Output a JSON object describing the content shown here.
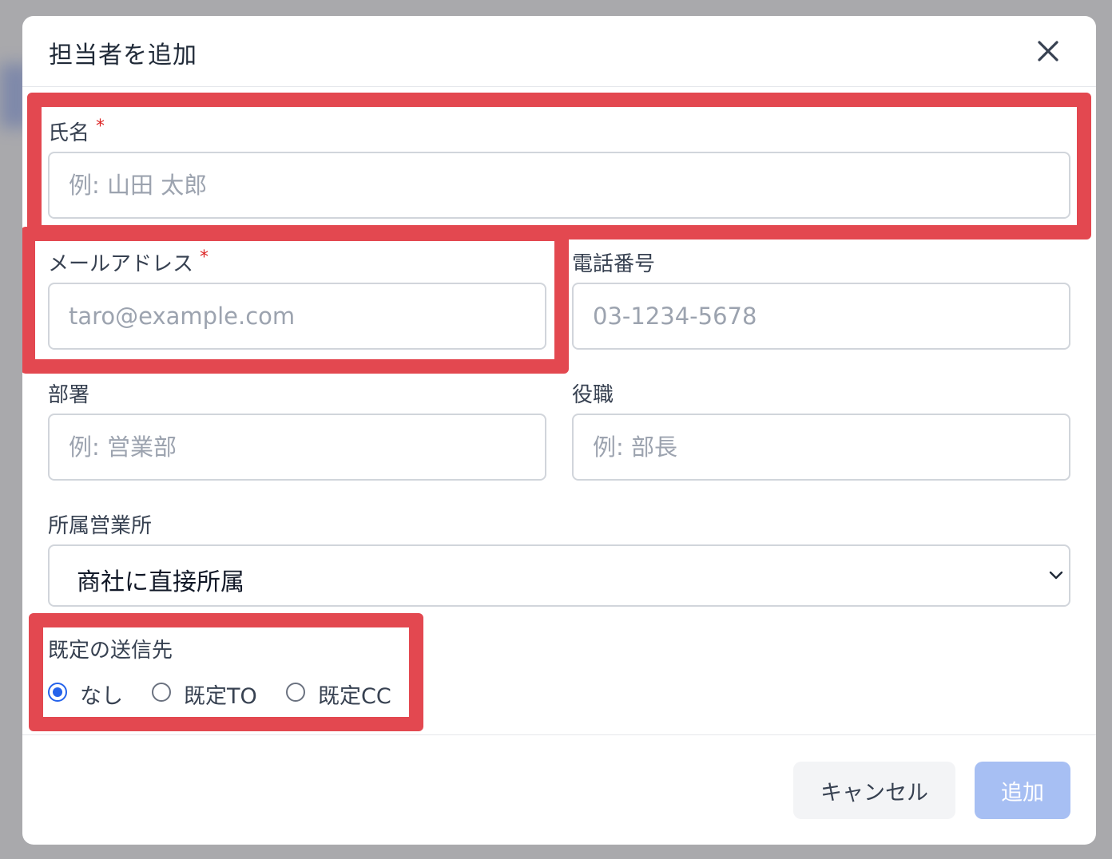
{
  "dialog": {
    "title": "担当者を追加",
    "close_icon": "close-icon"
  },
  "fields": {
    "name": {
      "label": "氏名",
      "required_mark": "*",
      "placeholder": "例: 山田 太郎",
      "value": ""
    },
    "email": {
      "label": "メールアドレス",
      "required_mark": "*",
      "placeholder": "taro@example.com",
      "value": ""
    },
    "phone": {
      "label": "電話番号",
      "placeholder": "03-1234-5678",
      "value": ""
    },
    "department": {
      "label": "部署",
      "placeholder": "例: 営業部",
      "value": ""
    },
    "position": {
      "label": "役職",
      "placeholder": "例: 部長",
      "value": ""
    },
    "office": {
      "label": "所属営業所",
      "selected": "商社に直接所属"
    },
    "default_recipient": {
      "label": "既定の送信先",
      "options": [
        {
          "label": "なし",
          "checked": true
        },
        {
          "label": "既定TO",
          "checked": false
        },
        {
          "label": "既定CC",
          "checked": false
        }
      ]
    }
  },
  "footer": {
    "cancel_label": "キャンセル",
    "add_label": "追加"
  },
  "colors": {
    "highlight": "#e34850",
    "accent": "#2563eb",
    "add_button_disabled": "#a7bff3",
    "required": "#dc2626"
  }
}
